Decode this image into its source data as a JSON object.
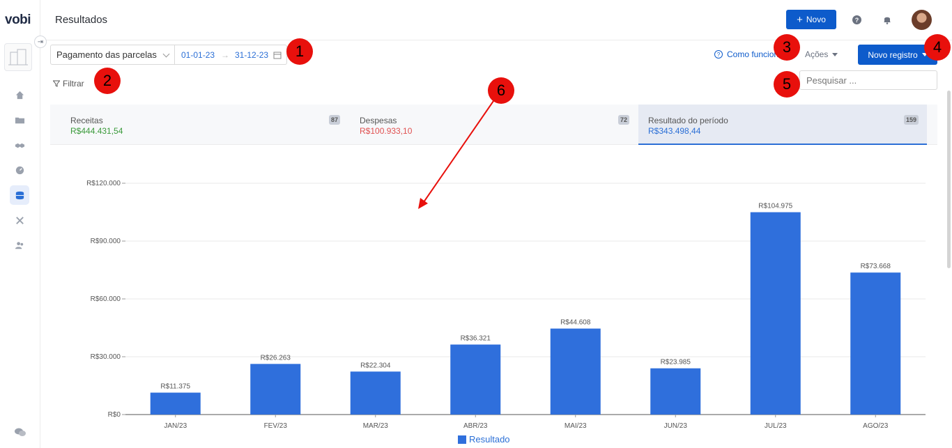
{
  "app": {
    "logo": "vobi",
    "page_title": "Resultados"
  },
  "header": {
    "new_button": "Novo",
    "new_icon": "plus-icon",
    "help_icon": "question-icon",
    "bell_icon": "bell-icon"
  },
  "filters": {
    "period_type": "Pagamento das parcelas",
    "date_start": "01-01-23",
    "date_end": "31-12-23",
    "filter_label": "Filtrar",
    "help_link": "Como funciona?",
    "actions_label": "Ações",
    "new_record_button": "Novo registro",
    "search_placeholder": "Pesquisar ..."
  },
  "summary": [
    {
      "label": "Receitas",
      "value": "R$444.431,54",
      "count": "87",
      "color": "#3a9a3a"
    },
    {
      "label": "Despesas",
      "value": "R$100.933,10",
      "count": "72",
      "color": "#e05050"
    },
    {
      "label": "Resultado do período",
      "value": "R$343.498,44",
      "count": "159",
      "color": "#2b6fd6"
    }
  ],
  "markers": [
    "1",
    "2",
    "3",
    "4",
    "5",
    "6"
  ],
  "chart_data": {
    "type": "bar",
    "categories": [
      "JAN/23",
      "FEV/23",
      "MAR/23",
      "ABR/23",
      "MAI/23",
      "JUN/23",
      "JUL/23",
      "AGO/23"
    ],
    "series": [
      {
        "name": "Resultado",
        "values": [
          11375,
          26263,
          22304,
          36321,
          44608,
          23985,
          104975,
          73668
        ],
        "color": "#2f6fdc"
      }
    ],
    "value_labels": [
      "R$11.375",
      "R$26.263",
      "R$22.304",
      "R$36.321",
      "R$44.608",
      "R$23.985",
      "R$104.975",
      "R$73.668"
    ],
    "y_ticks": [
      0,
      30000,
      60000,
      90000,
      120000
    ],
    "y_tick_labels": [
      "R$0",
      "R$30.000",
      "R$60.000",
      "R$90.000",
      "R$120.000"
    ],
    "ylim": [
      0,
      120000
    ],
    "grid": true,
    "legend": "bottom-center"
  }
}
